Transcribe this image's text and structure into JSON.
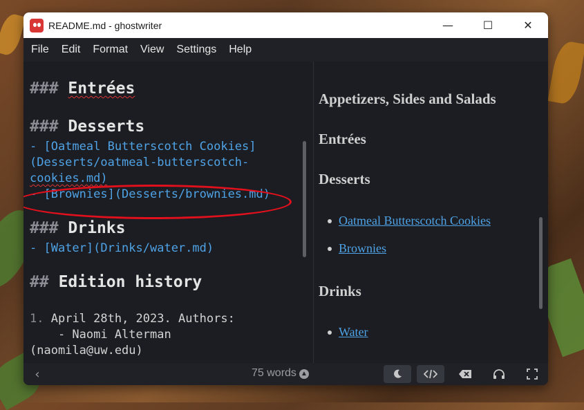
{
  "window": {
    "title": "README.md - ghostwriter",
    "controls": {
      "minimize": "—",
      "maximize": "☐",
      "close": "✕"
    }
  },
  "menu": [
    "File",
    "Edit",
    "Format",
    "View",
    "Settings",
    "Help"
  ],
  "editor": {
    "lines": {
      "entrees_hash": "###",
      "entrees_text": "Entrées",
      "desserts_hash": "###",
      "desserts_text": "Desserts",
      "cookies_line1": "- [Oatmeal Butterscotch Cookies]",
      "cookies_line2": "(Desserts/oatmeal-butterscotch-",
      "cookies_line3": "cookies.md)",
      "brownies_line": "- [Brownies](Desserts/brownies.md)",
      "drinks_hash": "###",
      "drinks_text": "Drinks",
      "water_line": "- [Water](Drinks/water.md)",
      "history_hash": "##",
      "history_text": "Edition history",
      "item_num": "1.",
      "item_text": "April 28th, 2023. Authors:",
      "author_line": "    - Naomi Alterman",
      "email_line": "(naomila@uw.edu)"
    }
  },
  "preview": {
    "headings": [
      "Appetizers, Sides and Salads",
      "Entrées",
      "Desserts",
      "Drinks"
    ],
    "dessert_links": [
      "Oatmeal Butterscotch Cookies",
      "Brownies"
    ],
    "drink_links": [
      "Water"
    ]
  },
  "status": {
    "word_count": "75 words",
    "icons": [
      "chevron-left-icon",
      "moon-icon",
      "code-icon",
      "backspace-icon",
      "headphones-icon",
      "fullscreen-icon"
    ]
  },
  "colors": {
    "link": "#4fa3e6",
    "annotation": "#e0101c",
    "background": "#1b1d22"
  }
}
